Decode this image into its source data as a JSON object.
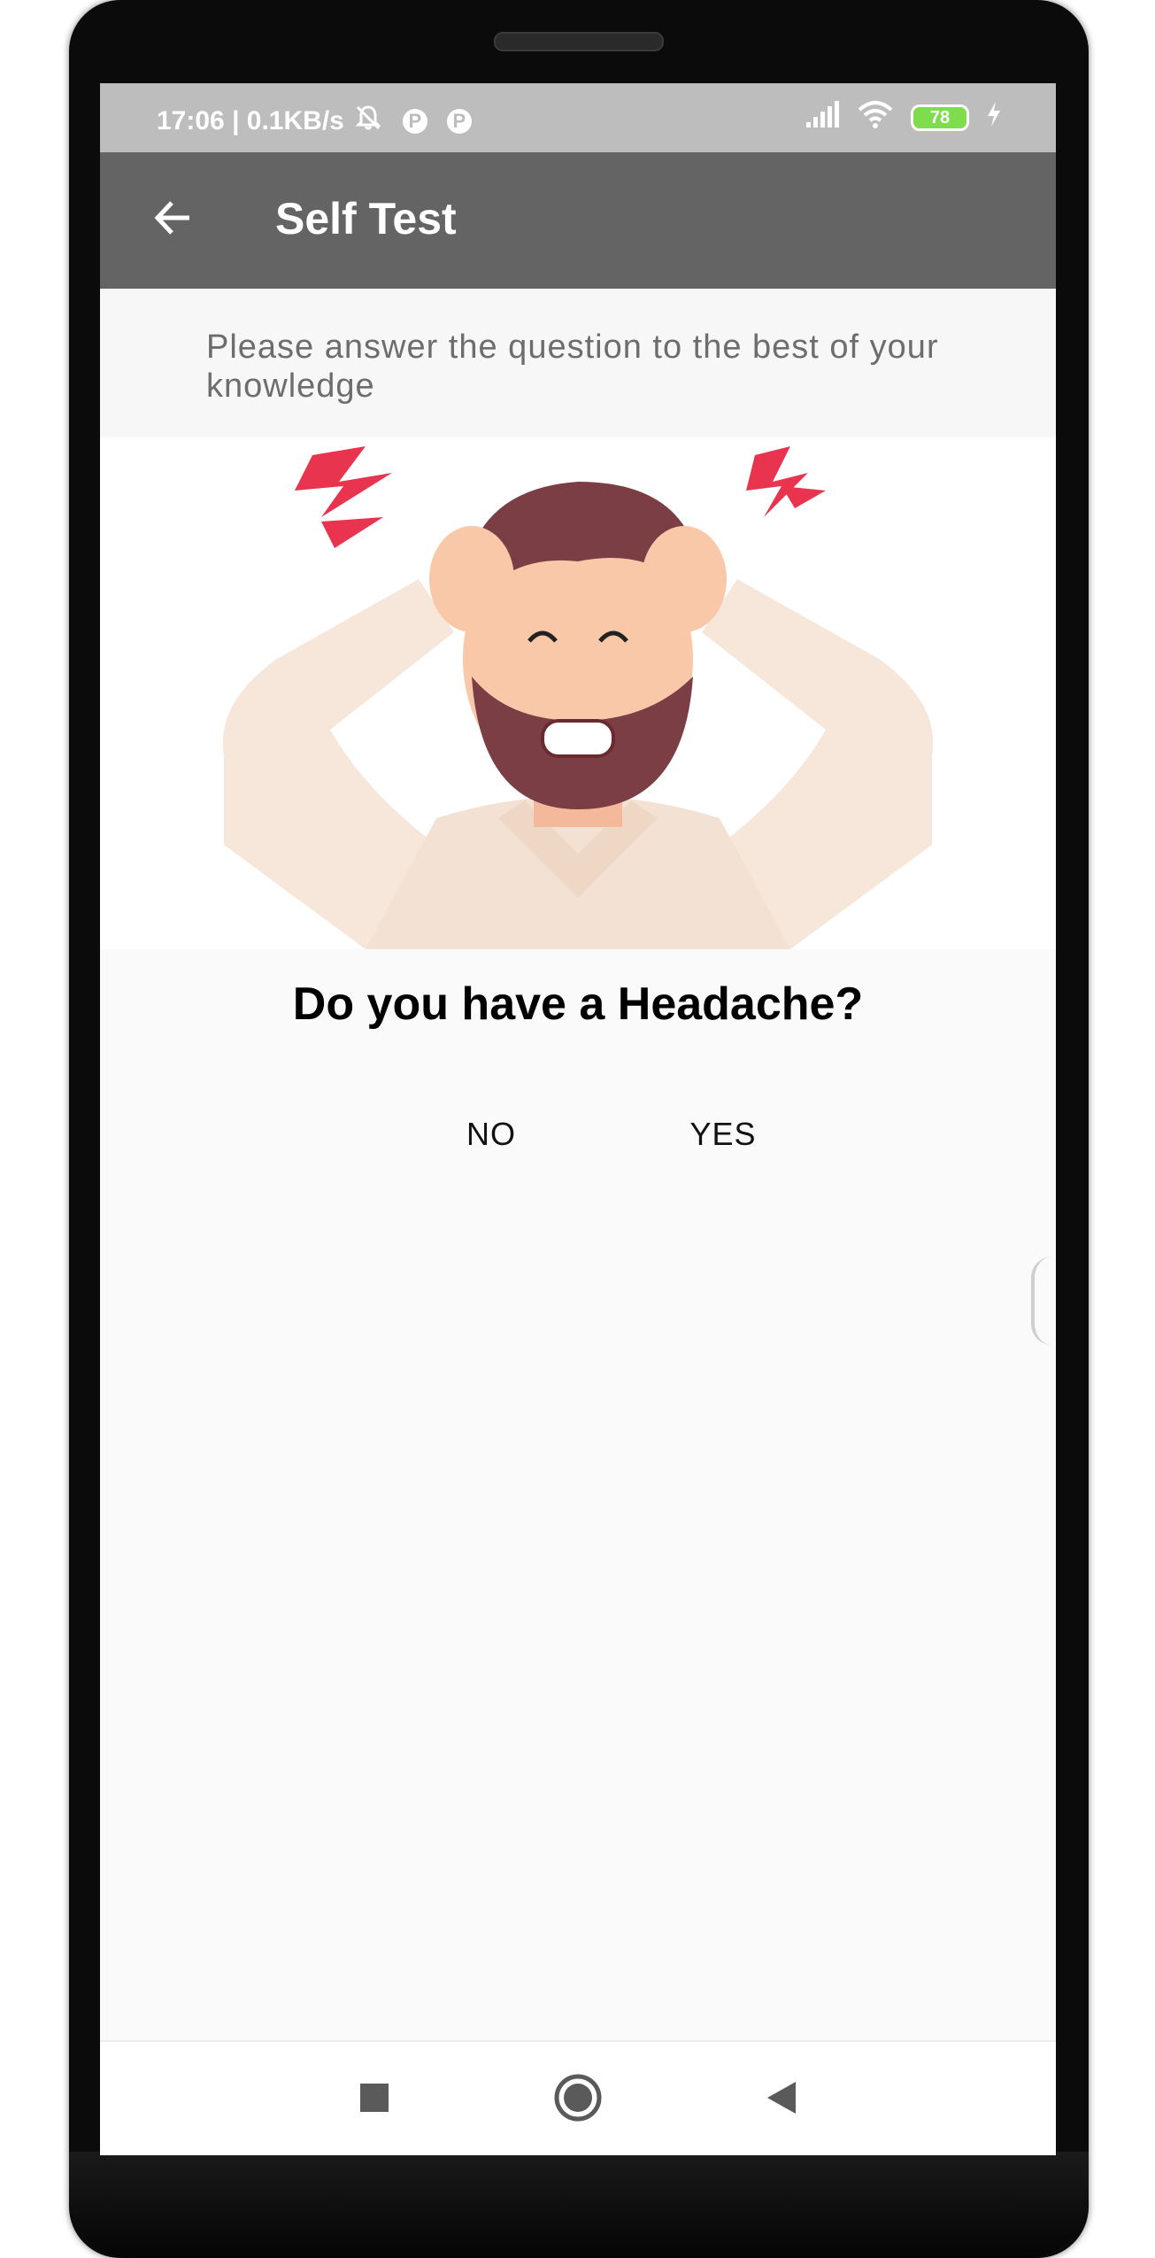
{
  "status_bar": {
    "time_speed": "17:06 | 0.1KB/s",
    "p_icon": "P",
    "battery_level": "78"
  },
  "app_bar": {
    "title": "Self Test",
    "back_icon": "arrow-left-icon"
  },
  "instruction": "Please answer the question to the best of your knowledge",
  "question": "Do you have a Headache?",
  "answers": {
    "no_label": "NO",
    "yes_label": "YES"
  },
  "nav_bar": {
    "recents_icon": "square-icon",
    "home_icon": "circle-icon",
    "back_icon": "triangle-back-icon"
  },
  "colors": {
    "status_bar": "#bdbdbd",
    "app_bar": "#646464",
    "background": "#fafafa",
    "battery": "#7fdc4c"
  }
}
